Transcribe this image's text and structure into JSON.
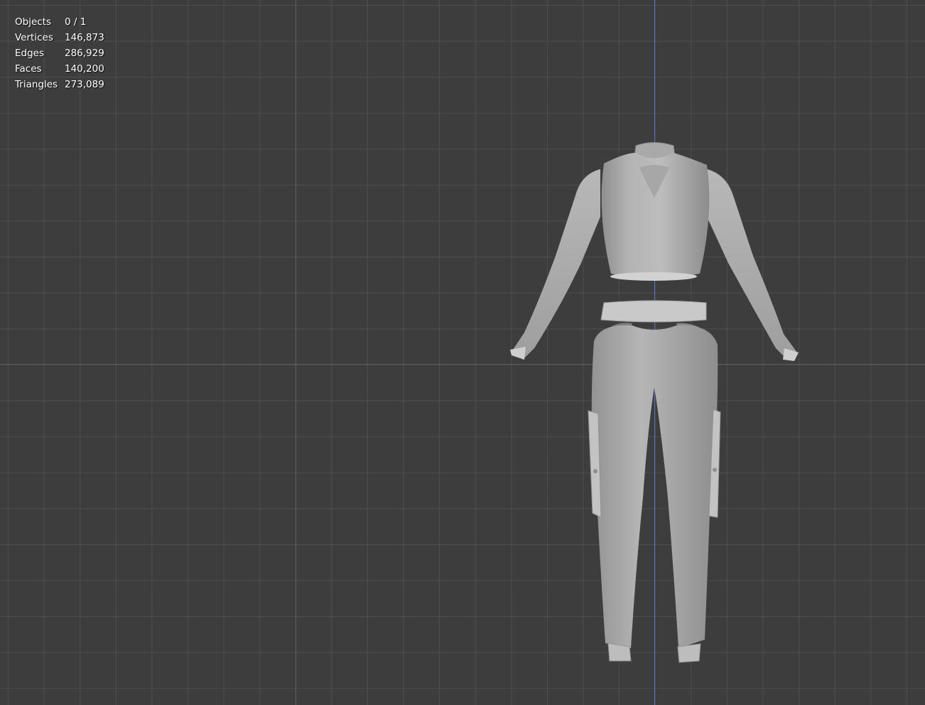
{
  "viewport": {
    "background_color": "#3d3d3d",
    "grid_color": "#5a5a5a",
    "axis_color": "#4a78c8",
    "model_color": "#b4b4b4"
  },
  "stats": {
    "rows": [
      {
        "label": "Objects",
        "value": "0 / 1"
      },
      {
        "label": "Vertices",
        "value": "146,873"
      },
      {
        "label": "Edges",
        "value": "286,929"
      },
      {
        "label": "Faces",
        "value": "140,200"
      },
      {
        "label": "Triangles",
        "value": "273,089"
      }
    ]
  }
}
